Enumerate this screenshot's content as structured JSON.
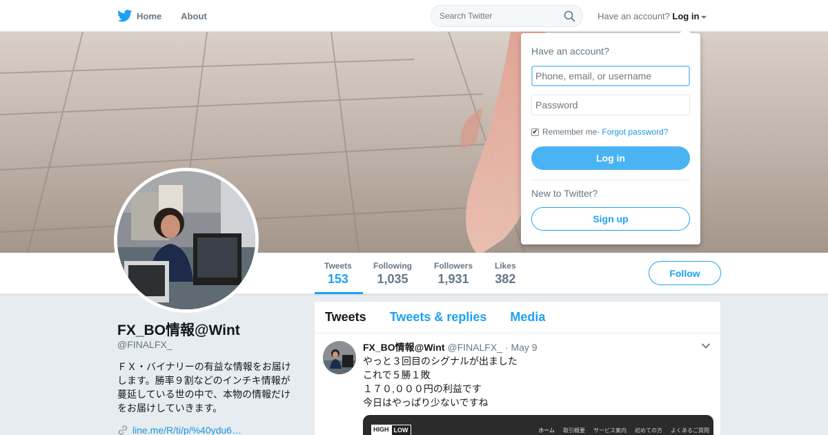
{
  "nav": {
    "home_label": "Home",
    "about_label": "About",
    "search_placeholder": "Search Twitter",
    "account_prompt": "Have an account?",
    "login_label": "Log in"
  },
  "dropdown": {
    "title": "Have an account?",
    "username_placeholder": "Phone, email, or username",
    "password_placeholder": "Password",
    "remember_label": "Remember me",
    "separator": " · ",
    "forgot_label": "Forgot password?",
    "login_button": "Log in",
    "new_prompt": "New to Twitter?",
    "signup_button": "Sign up"
  },
  "stats": [
    {
      "label": "Tweets",
      "value": "153"
    },
    {
      "label": "Following",
      "value": "1,035"
    },
    {
      "label": "Followers",
      "value": "1,931"
    },
    {
      "label": "Likes",
      "value": "382"
    }
  ],
  "follow_label": "Follow",
  "profile": {
    "name": "FX_BO情報@Wint",
    "handle": "@FINALFX_",
    "bio": "ＦＸ・バイナリーの有益な情報をお届けします。勝率９割などのインチキ情報が蔓延している世の中で、本物の情報だけをお届けしていきます。",
    "link": "line.me/R/ti/p/%40ydu6…"
  },
  "timeline": {
    "tabs": [
      "Tweets",
      "Tweets & replies",
      "Media"
    ]
  },
  "tweet": {
    "name": "FX_BO情報@Wint",
    "handle": "@FINALFX_",
    "date": "· May 9",
    "lines": [
      "やっと３回目のシグナルが出ました",
      "これで５勝１敗",
      "１７０,０００円の利益です",
      "今日はやっぱり少ないですね"
    ],
    "media_logo_a": "HIGH",
    "media_logo_b": "LOW",
    "media_menu": [
      "ホーム",
      "取引概要",
      "サービス案内",
      "初めての方",
      "よくあるご質問"
    ]
  },
  "colors": {
    "accent": "#1da1f2",
    "button_fill": "#4ab3f4",
    "background": "#e6ecf0"
  }
}
